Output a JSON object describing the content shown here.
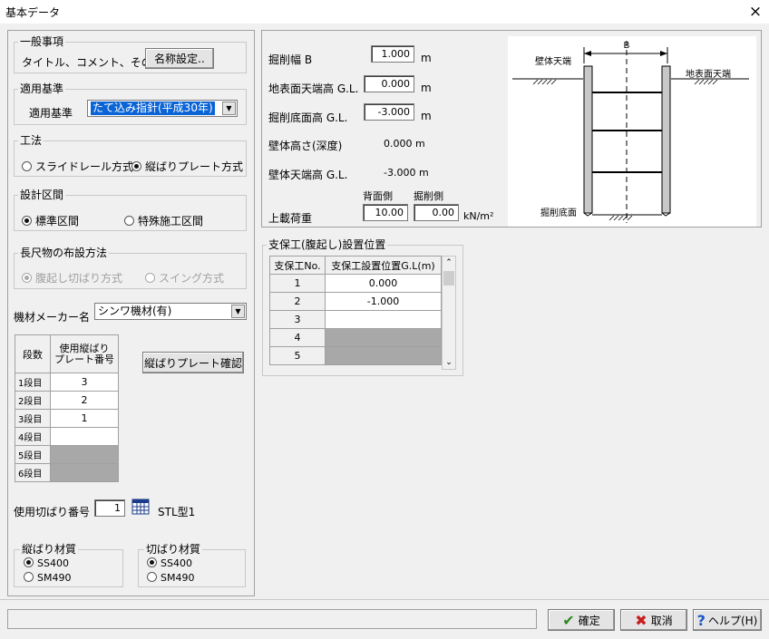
{
  "window": {
    "title": "基本データ",
    "close_icon": "×"
  },
  "general": {
    "group_label": "一般事項",
    "row_label": "タイトル、コメント、その他:",
    "name_button": "名称設定.."
  },
  "standard": {
    "group_label": "適用基準",
    "row_label": "適用基準",
    "selected": "たて込み指針(平成30年)"
  },
  "method": {
    "group_label": "工法",
    "options": [
      "スライドレール方式",
      "縦ばりプレート方式"
    ],
    "selected_index": 1
  },
  "section": {
    "group_label": "設計区間",
    "options": [
      "標準区間",
      "特殊施工区間"
    ],
    "selected_index": 0
  },
  "long_layout": {
    "group_label": "長尺物の布設方法",
    "options": [
      "腹起し切ばり方式",
      "スイング方式"
    ],
    "selected_index": 0
  },
  "maker": {
    "label": "機材メーカー名",
    "selected": "シンワ機材(有)"
  },
  "stage_table": {
    "headers": [
      "段数",
      "使用縦ばり\nプレート番号"
    ],
    "rows": [
      {
        "stage": "1段目",
        "value": "3"
      },
      {
        "stage": "2段目",
        "value": "2"
      },
      {
        "stage": "3段目",
        "value": "1"
      },
      {
        "stage": "4段目",
        "value": ""
      },
      {
        "stage": "5段目",
        "value": ""
      },
      {
        "stage": "6段目",
        "value": ""
      }
    ],
    "disabled_from": 4
  },
  "plate_check_button": "縦ばりプレート確認",
  "strut": {
    "label": "使用切ばり番号",
    "value": "1",
    "type_text": "STL型1"
  },
  "vertical_material": {
    "group_label": "縦ばり材質",
    "options": [
      "SS400",
      "SM490"
    ],
    "selected_index": 0
  },
  "strut_material": {
    "group_label": "切ばり材質",
    "options": [
      "SS400",
      "SM490"
    ],
    "selected_index": 0
  },
  "dims": {
    "width_label": "掘削幅 B",
    "width_value": "1.000",
    "width_unit": "m",
    "ground_label": "地表面天端高  G.L.",
    "ground_value": "0.000",
    "ground_unit": "m",
    "bottom_label": "掘削底面高     G.L.",
    "bottom_value": "-3.000",
    "bottom_unit": "m",
    "wall_height_label": "壁体高さ(深度)",
    "wall_height_value": "0.000 m",
    "wall_top_label": "壁体天端高 G.L.",
    "wall_top_value": "-3.000 m",
    "back_label": "背面側",
    "excav_label": "掘削側",
    "load_label": "上載荷重",
    "load_back": "10.00",
    "load_excav": "0.00",
    "load_unit": "kN/m²"
  },
  "diagram": {
    "b_label": "B",
    "wall_top": "壁体天端",
    "ground_top": "地表面天端",
    "bottom": "掘削底面"
  },
  "support": {
    "group_label": "支保工(腹起し)設置位置",
    "headers": [
      "支保工No.",
      "支保工設置位置G.L(m)"
    ],
    "rows": [
      {
        "no": "1",
        "pos": "0.000"
      },
      {
        "no": "2",
        "pos": "-1.000"
      },
      {
        "no": "3",
        "pos": ""
      },
      {
        "no": "4",
        "pos": ""
      },
      {
        "no": "5",
        "pos": ""
      }
    ],
    "disabled_from": 3
  },
  "footer": {
    "ok": "確定",
    "cancel": "取消",
    "help": "ヘルプ(H)"
  }
}
